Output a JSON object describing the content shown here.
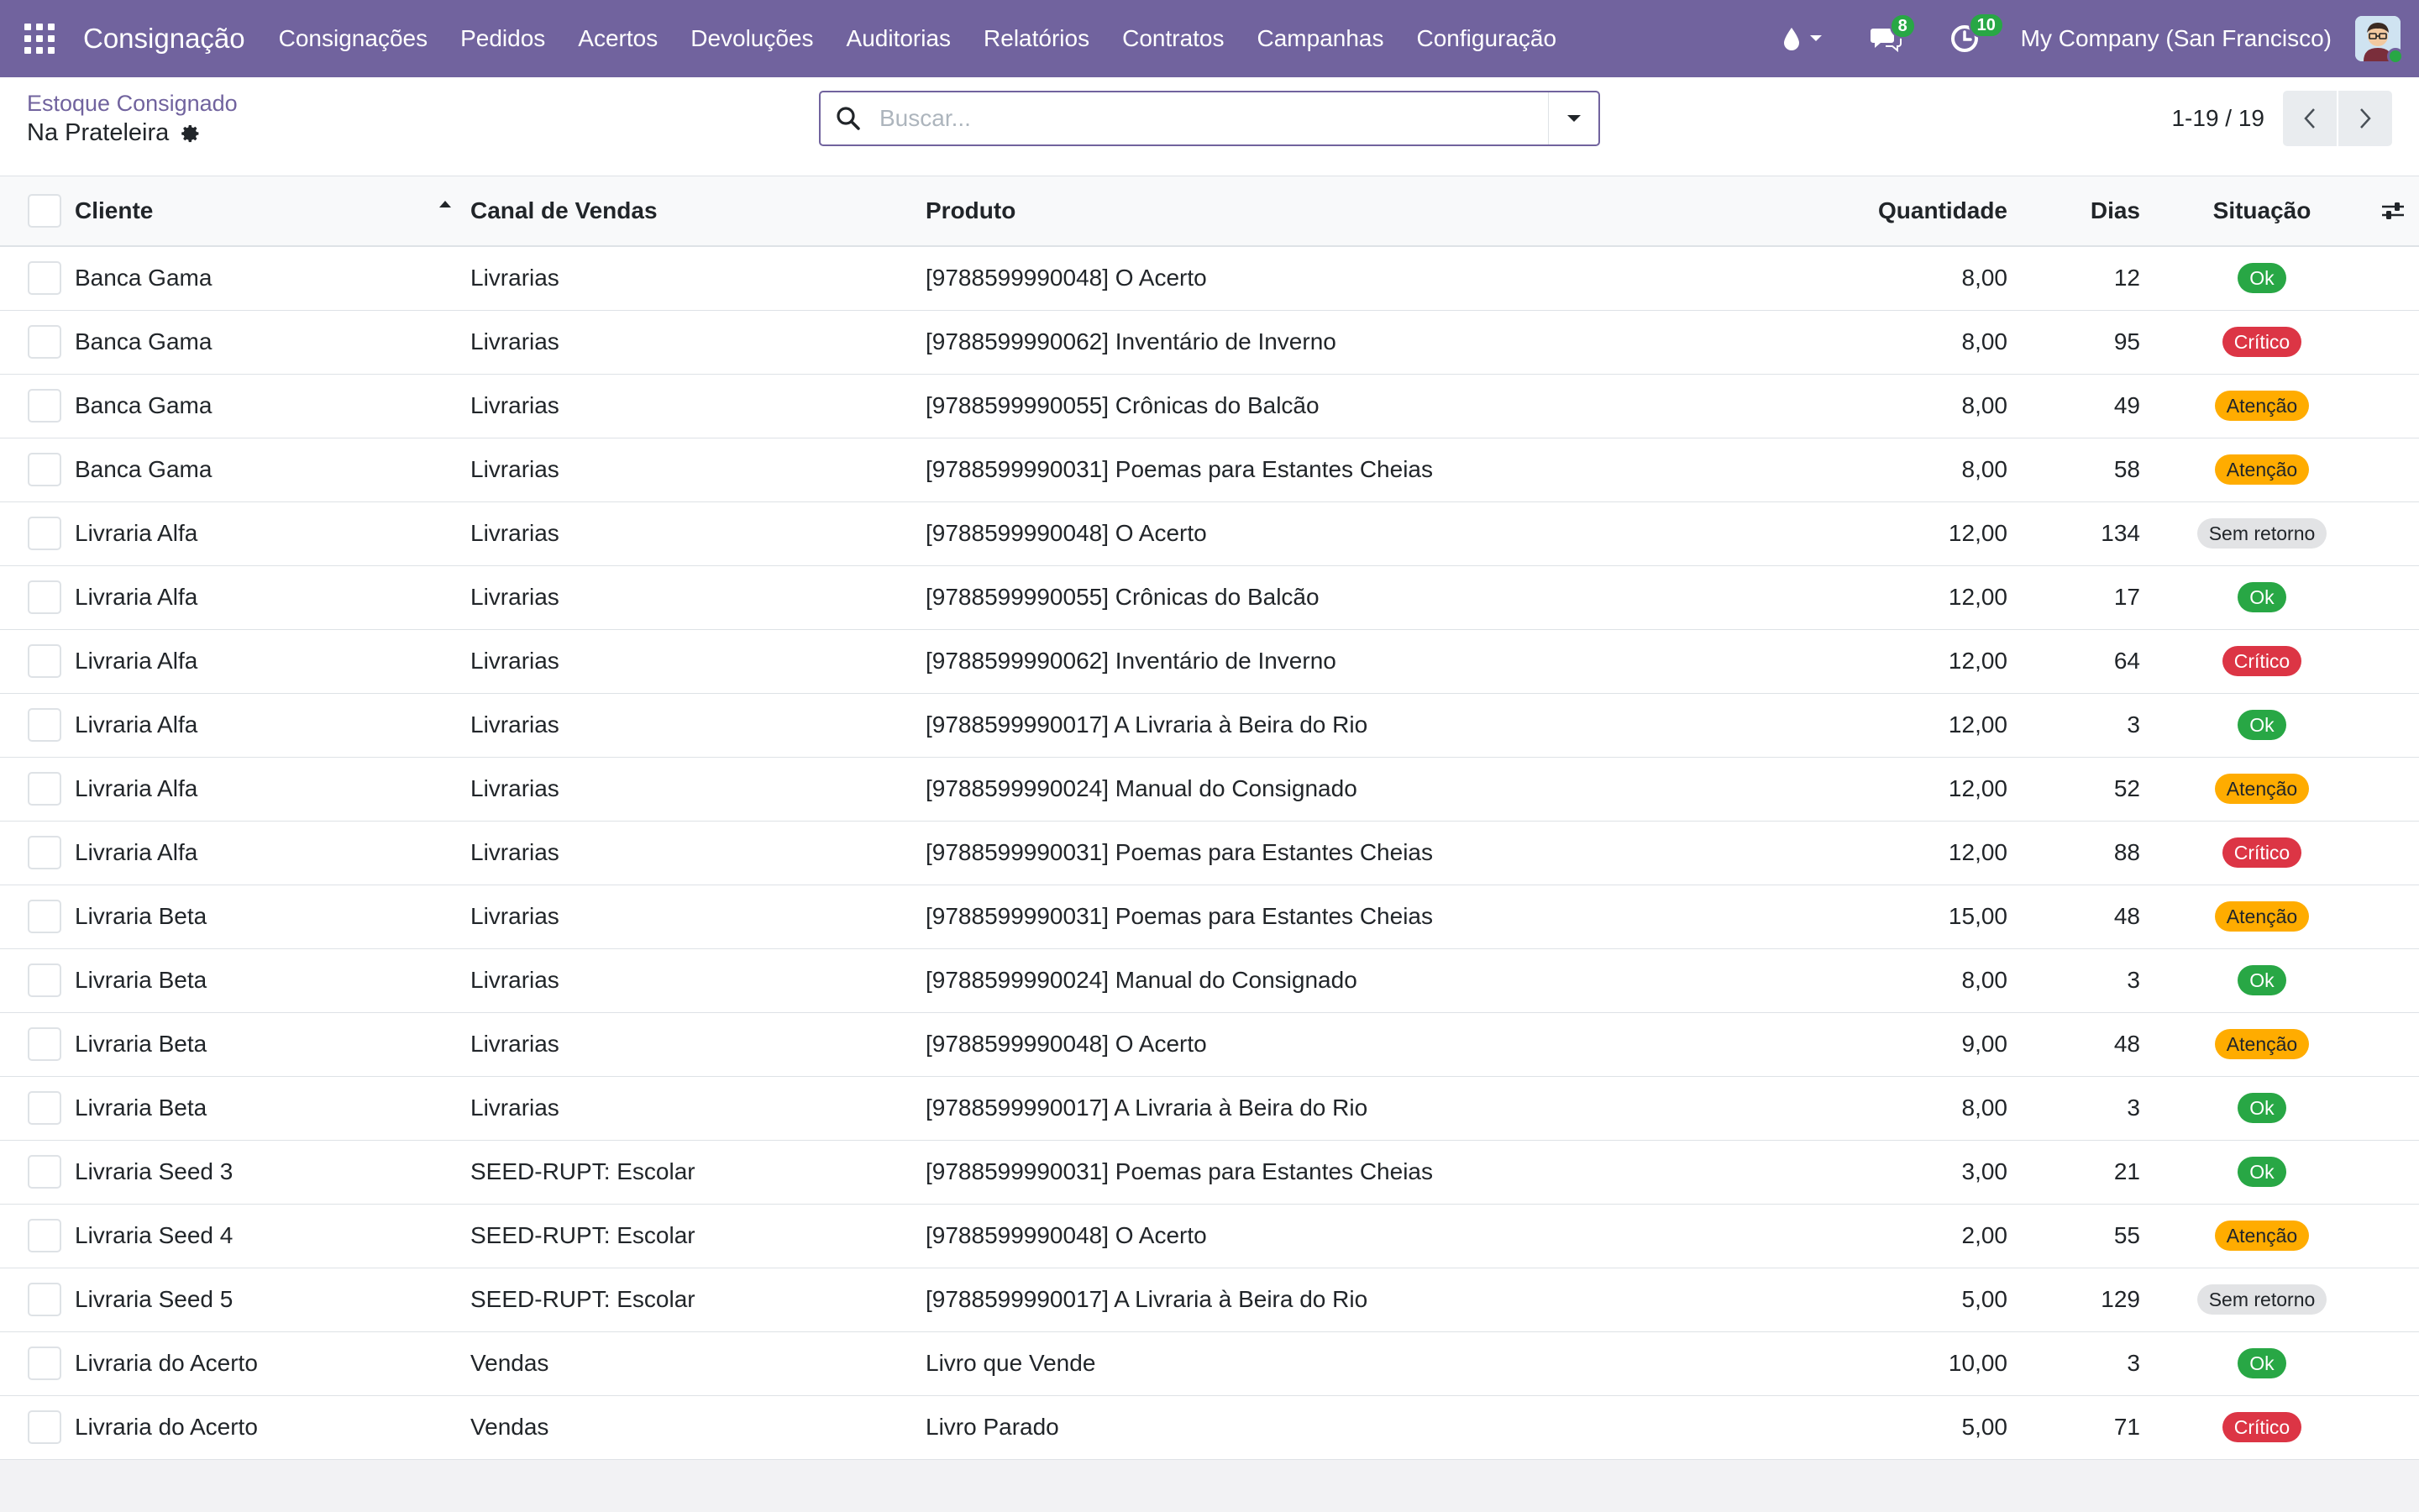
{
  "navbar": {
    "app_name": "Consignação",
    "menu": [
      "Consignações",
      "Pedidos",
      "Acertos",
      "Devoluções",
      "Auditorias",
      "Relatórios",
      "Contratos",
      "Campanhas",
      "Configuração"
    ],
    "messages_count": "8",
    "activities_count": "10",
    "company": "My Company (San Francisco)",
    "icons": [
      "apps-grid-icon",
      "drop-icon",
      "caret-down-icon",
      "chat-icon",
      "clock-icon",
      "avatar"
    ]
  },
  "control_panel": {
    "breadcrumb": "Estoque Consignado",
    "title": "Na Prateleira",
    "search_placeholder": "Buscar...",
    "pager": "1-19 / 19"
  },
  "table": {
    "headers": {
      "cliente": "Cliente",
      "canal": "Canal de Vendas",
      "produto": "Produto",
      "quantidade": "Quantidade",
      "dias": "Dias",
      "situacao": "Situação"
    },
    "rows": [
      {
        "cliente": "Banca Gama",
        "canal": "Livrarias",
        "produto": "[9788599990048] O Acerto",
        "quantidade": "8,00",
        "dias": "12",
        "situacao": "Ok",
        "status": "ok"
      },
      {
        "cliente": "Banca Gama",
        "canal": "Livrarias",
        "produto": "[9788599990062] Inventário de Inverno",
        "quantidade": "8,00",
        "dias": "95",
        "situacao": "Crítico",
        "status": "critico"
      },
      {
        "cliente": "Banca Gama",
        "canal": "Livrarias",
        "produto": "[9788599990055] Crônicas do Balcão",
        "quantidade": "8,00",
        "dias": "49",
        "situacao": "Atenção",
        "status": "atencao"
      },
      {
        "cliente": "Banca Gama",
        "canal": "Livrarias",
        "produto": "[9788599990031] Poemas para Estantes Cheias",
        "quantidade": "8,00",
        "dias": "58",
        "situacao": "Atenção",
        "status": "atencao"
      },
      {
        "cliente": "Livraria Alfa",
        "canal": "Livrarias",
        "produto": "[9788599990048] O Acerto",
        "quantidade": "12,00",
        "dias": "134",
        "situacao": "Sem retorno",
        "status": "semretorno"
      },
      {
        "cliente": "Livraria Alfa",
        "canal": "Livrarias",
        "produto": "[9788599990055] Crônicas do Balcão",
        "quantidade": "12,00",
        "dias": "17",
        "situacao": "Ok",
        "status": "ok"
      },
      {
        "cliente": "Livraria Alfa",
        "canal": "Livrarias",
        "produto": "[9788599990062] Inventário de Inverno",
        "quantidade": "12,00",
        "dias": "64",
        "situacao": "Crítico",
        "status": "critico"
      },
      {
        "cliente": "Livraria Alfa",
        "canal": "Livrarias",
        "produto": "[9788599990017] A Livraria à Beira do Rio",
        "quantidade": "12,00",
        "dias": "3",
        "situacao": "Ok",
        "status": "ok"
      },
      {
        "cliente": "Livraria Alfa",
        "canal": "Livrarias",
        "produto": "[9788599990024] Manual do Consignado",
        "quantidade": "12,00",
        "dias": "52",
        "situacao": "Atenção",
        "status": "atencao"
      },
      {
        "cliente": "Livraria Alfa",
        "canal": "Livrarias",
        "produto": "[9788599990031] Poemas para Estantes Cheias",
        "quantidade": "12,00",
        "dias": "88",
        "situacao": "Crítico",
        "status": "critico"
      },
      {
        "cliente": "Livraria Beta",
        "canal": "Livrarias",
        "produto": "[9788599990031] Poemas para Estantes Cheias",
        "quantidade": "15,00",
        "dias": "48",
        "situacao": "Atenção",
        "status": "atencao"
      },
      {
        "cliente": "Livraria Beta",
        "canal": "Livrarias",
        "produto": "[9788599990024] Manual do Consignado",
        "quantidade": "8,00",
        "dias": "3",
        "situacao": "Ok",
        "status": "ok"
      },
      {
        "cliente": "Livraria Beta",
        "canal": "Livrarias",
        "produto": "[9788599990048] O Acerto",
        "quantidade": "9,00",
        "dias": "48",
        "situacao": "Atenção",
        "status": "atencao"
      },
      {
        "cliente": "Livraria Beta",
        "canal": "Livrarias",
        "produto": "[9788599990017] A Livraria à Beira do Rio",
        "quantidade": "8,00",
        "dias": "3",
        "situacao": "Ok",
        "status": "ok"
      },
      {
        "cliente": "Livraria Seed 3",
        "canal": "SEED-RUPT: Escolar",
        "produto": "[9788599990031] Poemas para Estantes Cheias",
        "quantidade": "3,00",
        "dias": "21",
        "situacao": "Ok",
        "status": "ok"
      },
      {
        "cliente": "Livraria Seed 4",
        "canal": "SEED-RUPT: Escolar",
        "produto": "[9788599990048] O Acerto",
        "quantidade": "2,00",
        "dias": "55",
        "situacao": "Atenção",
        "status": "atencao"
      },
      {
        "cliente": "Livraria Seed 5",
        "canal": "SEED-RUPT: Escolar",
        "produto": "[9788599990017] A Livraria à Beira do Rio",
        "quantidade": "5,00",
        "dias": "129",
        "situacao": "Sem retorno",
        "status": "semretorno"
      },
      {
        "cliente": "Livraria do Acerto",
        "canal": "Vendas",
        "produto": "Livro que Vende",
        "quantidade": "10,00",
        "dias": "3",
        "situacao": "Ok",
        "status": "ok"
      },
      {
        "cliente": "Livraria do Acerto",
        "canal": "Vendas",
        "produto": "Livro Parado",
        "quantidade": "5,00",
        "dias": "71",
        "situacao": "Crítico",
        "status": "critico"
      }
    ]
  },
  "colors": {
    "navbar": "#71639e",
    "ok": "#28a745",
    "critico": "#dc3545",
    "atencao": "#ffac00",
    "semretorno": "#e2e3e5"
  }
}
